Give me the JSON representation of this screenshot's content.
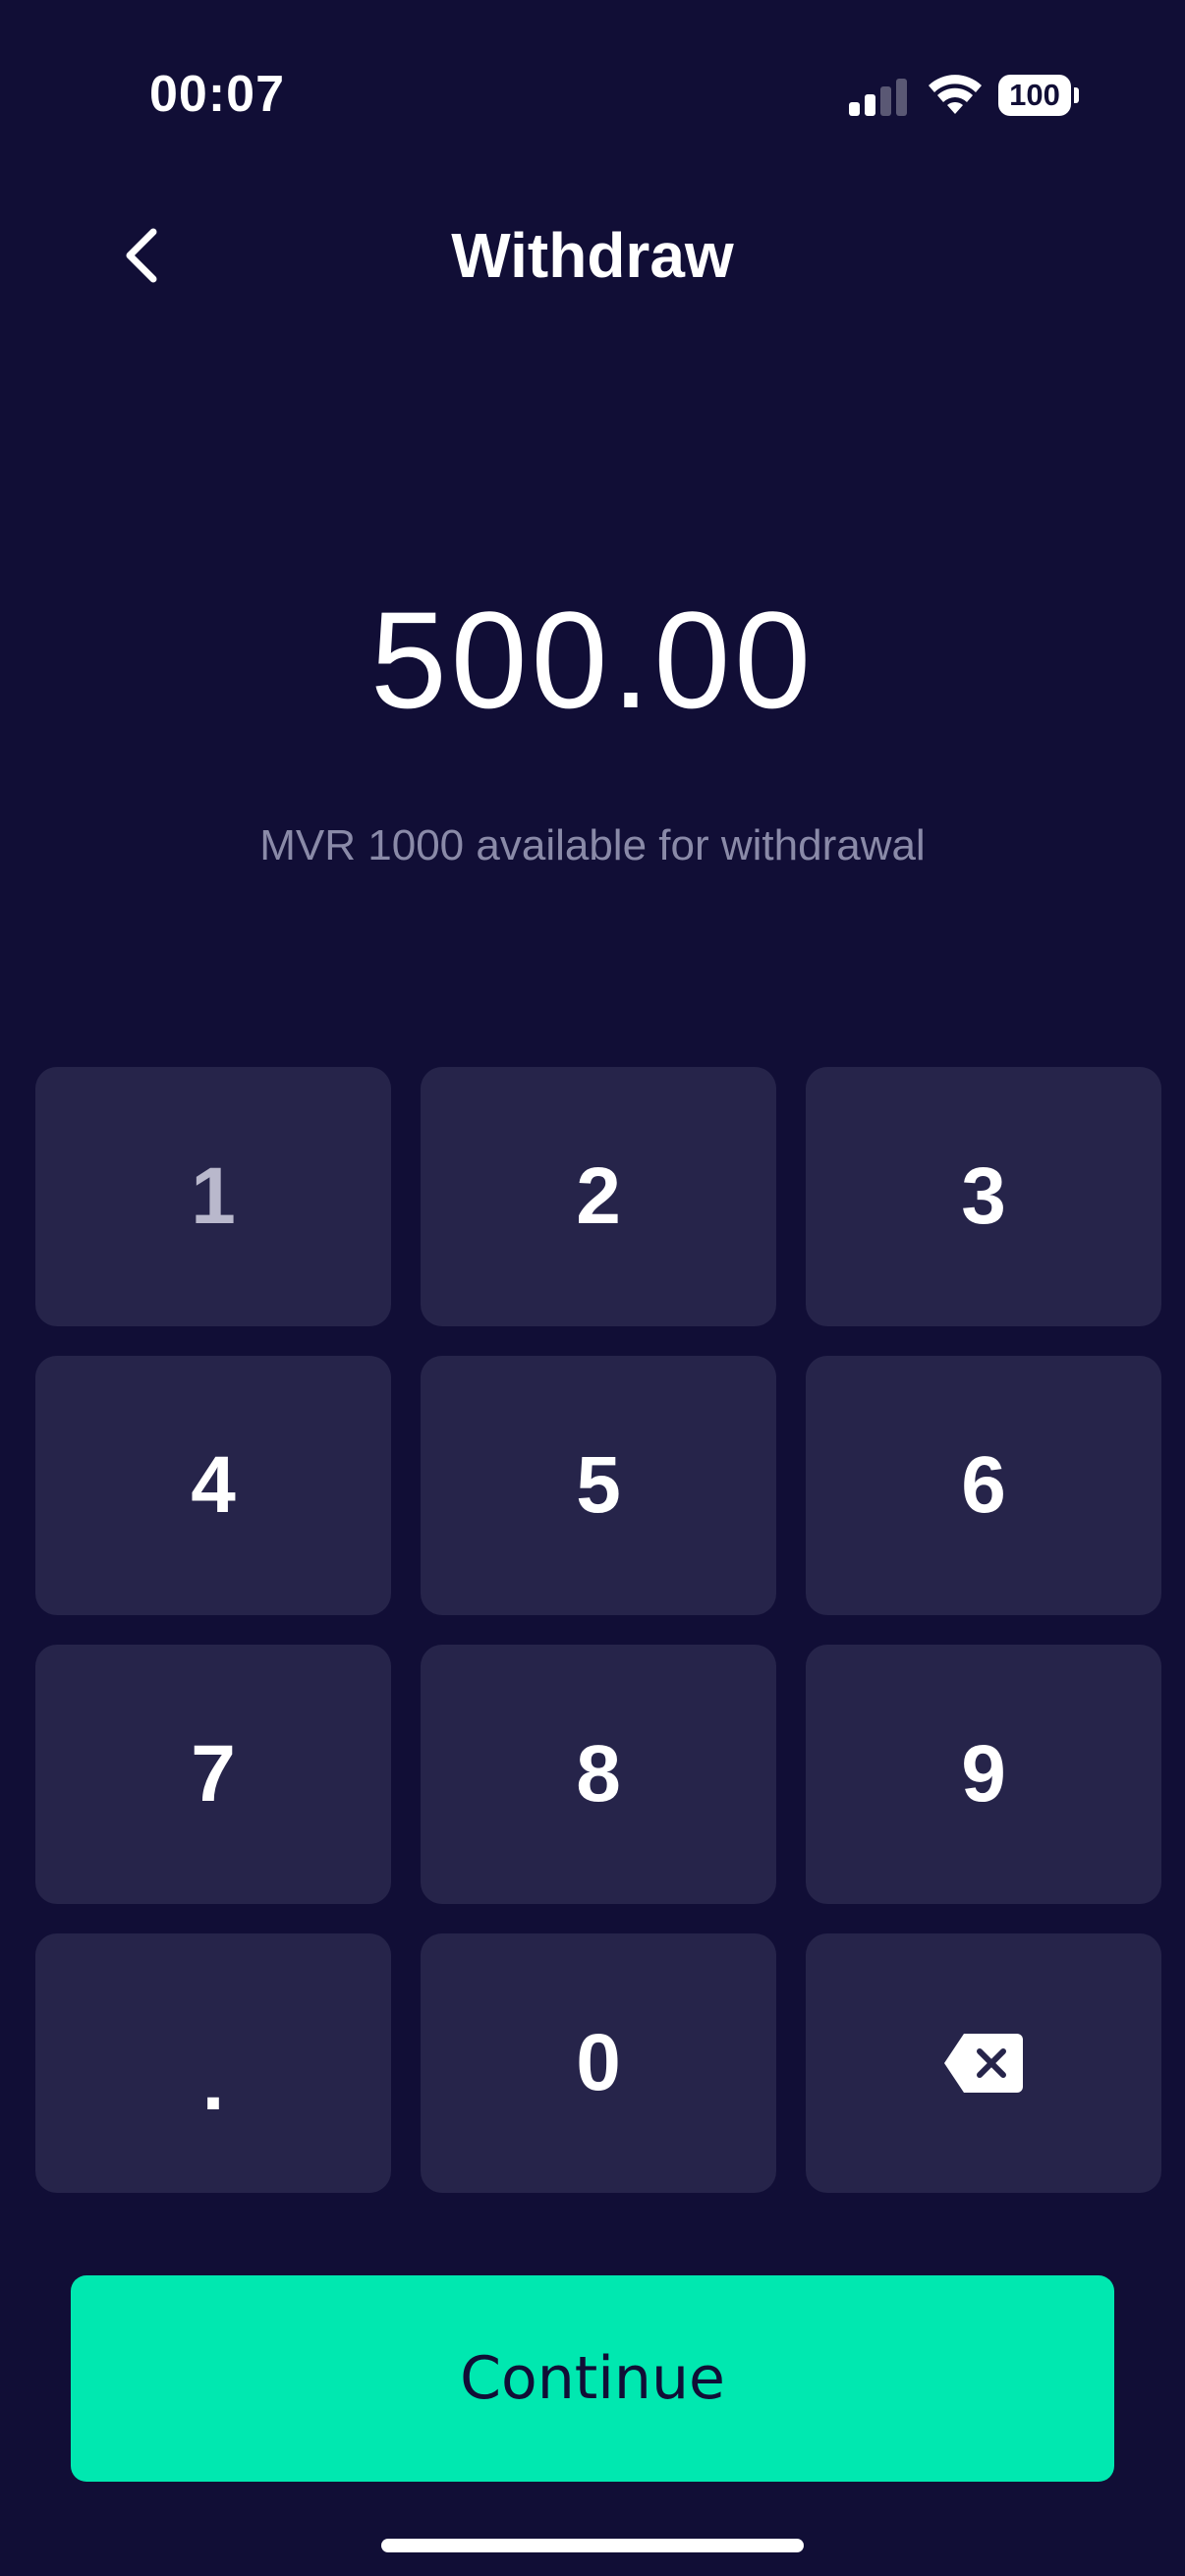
{
  "status_bar": {
    "time": "00:07",
    "battery": "100",
    "signal_bars_active": 2,
    "signal_bars_total": 4
  },
  "header": {
    "title": "Withdraw",
    "back_icon": "chevron-left-icon"
  },
  "amount": {
    "value": "500.00"
  },
  "available_text": "MVR 1000 available for withdrawal",
  "keypad": {
    "keys": [
      "1",
      "2",
      "3",
      "4",
      "5",
      "6",
      "7",
      "8",
      "9",
      ".",
      "0"
    ],
    "backspace_icon": "backspace-icon"
  },
  "continue_label": "Continue",
  "colors": {
    "background": "#110e36",
    "key_background": "#26244a",
    "accent": "#00e8b0",
    "secondary_text": "#8a8aa8"
  }
}
